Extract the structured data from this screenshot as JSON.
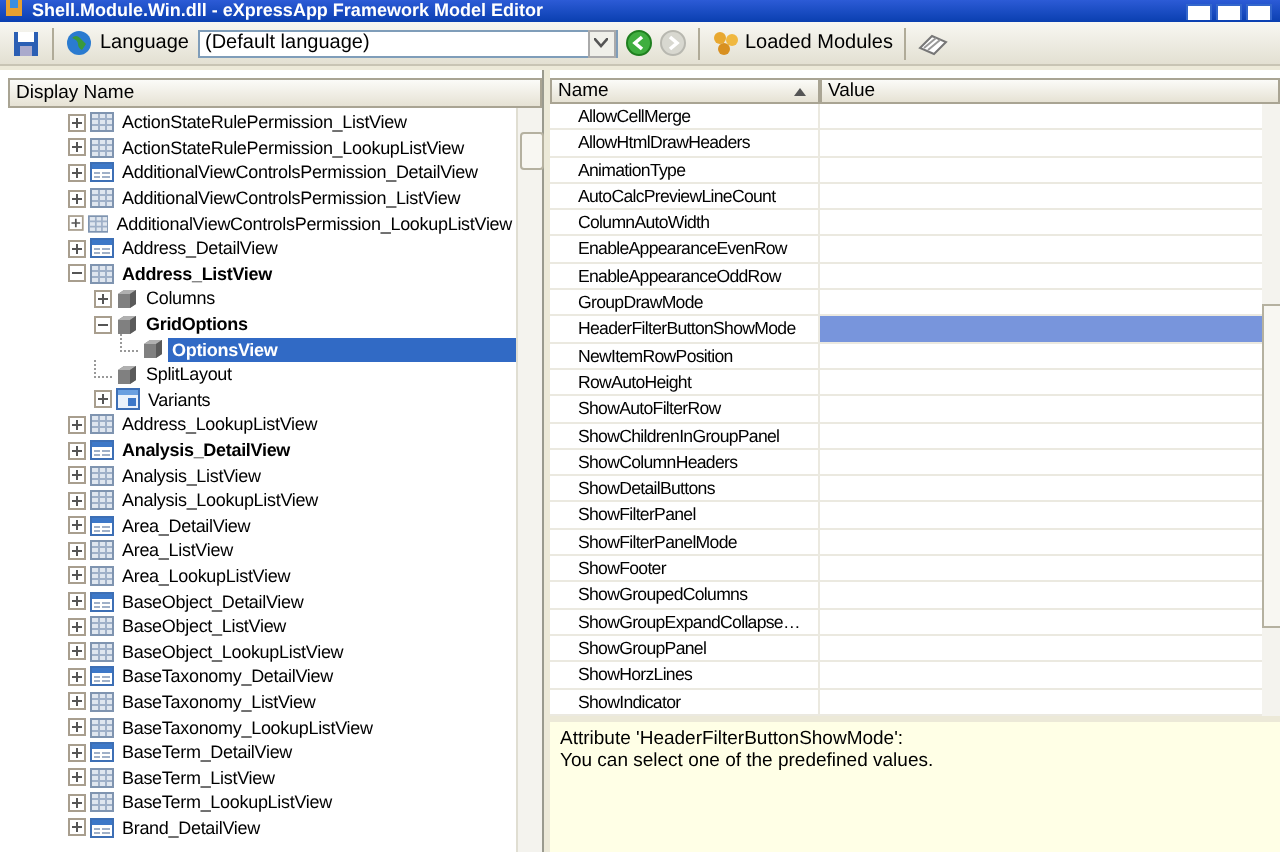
{
  "window": {
    "title": "Shell.Module.Win.dll - eXpressApp Framework Model Editor"
  },
  "toolbar": {
    "language_label": "Language",
    "language_value": "(Default language)",
    "nav_buttons": [
      {
        "kind": "back",
        "disabled": false
      },
      {
        "kind": "forward",
        "disabled": true
      }
    ],
    "loaded_modules_label": "Loaded Modules"
  },
  "tree": {
    "header": "Display Name",
    "items": [
      {
        "label": "ActionStateRulePermission_ListView",
        "kind": "list",
        "leaf": false,
        "expanded": false,
        "bold": false,
        "selected": false
      },
      {
        "label": "ActionStateRulePermission_LookupListView",
        "kind": "list",
        "leaf": false,
        "expanded": false,
        "bold": false,
        "selected": false
      },
      {
        "label": "AdditionalViewControlsPermission_DetailView",
        "kind": "detail",
        "leaf": false,
        "expanded": false,
        "bold": false,
        "selected": false
      },
      {
        "label": "AdditionalViewControlsPermission_ListView",
        "kind": "list",
        "leaf": false,
        "expanded": false,
        "bold": false,
        "selected": false
      },
      {
        "label": "AdditionalViewControlsPermission_LookupListView",
        "kind": "list",
        "leaf": false,
        "expanded": false,
        "bold": false,
        "selected": false
      },
      {
        "label": "Address_DetailView",
        "kind": "detail",
        "leaf": false,
        "expanded": false,
        "bold": false,
        "selected": false
      },
      {
        "label": "Address_ListView",
        "kind": "list",
        "leaf": false,
        "expanded": true,
        "bold": true,
        "selected": false,
        "children": [
          {
            "label": "Columns",
            "kind": "node",
            "leaf": false,
            "expanded": false,
            "bold": false,
            "selected": false
          },
          {
            "label": "GridOptions",
            "kind": "node",
            "leaf": false,
            "expanded": true,
            "bold": true,
            "selected": false,
            "children": [
              {
                "label": "OptionsView",
                "kind": "node",
                "leaf": true,
                "bold": true,
                "selected": true
              }
            ]
          },
          {
            "label": "SplitLayout",
            "kind": "node",
            "leaf": true,
            "bold": false,
            "selected": false
          },
          {
            "label": "Variants",
            "kind": "variants",
            "leaf": false,
            "expanded": false,
            "bold": false,
            "selected": false
          }
        ]
      },
      {
        "label": "Address_LookupListView",
        "kind": "list",
        "leaf": false,
        "expanded": false,
        "bold": false,
        "selected": false
      },
      {
        "label": "Analysis_DetailView",
        "kind": "detail",
        "leaf": false,
        "expanded": false,
        "bold": true,
        "selected": false
      },
      {
        "label": "Analysis_ListView",
        "kind": "list",
        "leaf": false,
        "expanded": false,
        "bold": false,
        "selected": false
      },
      {
        "label": "Analysis_LookupListView",
        "kind": "list",
        "leaf": false,
        "expanded": false,
        "bold": false,
        "selected": false
      },
      {
        "label": "Area_DetailView",
        "kind": "detail",
        "leaf": false,
        "expanded": false,
        "bold": false,
        "selected": false
      },
      {
        "label": "Area_ListView",
        "kind": "list",
        "leaf": false,
        "expanded": false,
        "bold": false,
        "selected": false
      },
      {
        "label": "Area_LookupListView",
        "kind": "list",
        "leaf": false,
        "expanded": false,
        "bold": false,
        "selected": false
      },
      {
        "label": "BaseObject_DetailView",
        "kind": "detail",
        "leaf": false,
        "expanded": false,
        "bold": false,
        "selected": false
      },
      {
        "label": "BaseObject_ListView",
        "kind": "list",
        "leaf": false,
        "expanded": false,
        "bold": false,
        "selected": false
      },
      {
        "label": "BaseObject_LookupListView",
        "kind": "list",
        "leaf": false,
        "expanded": false,
        "bold": false,
        "selected": false
      },
      {
        "label": "BaseTaxonomy_DetailView",
        "kind": "detail",
        "leaf": false,
        "expanded": false,
        "bold": false,
        "selected": false
      },
      {
        "label": "BaseTaxonomy_ListView",
        "kind": "list",
        "leaf": false,
        "expanded": false,
        "bold": false,
        "selected": false
      },
      {
        "label": "BaseTaxonomy_LookupListView",
        "kind": "list",
        "leaf": false,
        "expanded": false,
        "bold": false,
        "selected": false
      },
      {
        "label": "BaseTerm_DetailView",
        "kind": "detail",
        "leaf": false,
        "expanded": false,
        "bold": false,
        "selected": false
      },
      {
        "label": "BaseTerm_ListView",
        "kind": "list",
        "leaf": false,
        "expanded": false,
        "bold": false,
        "selected": false
      },
      {
        "label": "BaseTerm_LookupListView",
        "kind": "list",
        "leaf": false,
        "expanded": false,
        "bold": false,
        "selected": false
      },
      {
        "label": "Brand_DetailView",
        "kind": "detail",
        "leaf": false,
        "expanded": false,
        "bold": false,
        "selected": false
      }
    ]
  },
  "properties": {
    "columns": [
      "Name",
      "Value"
    ],
    "rows": [
      {
        "name": "AllowCellMerge",
        "selected": false
      },
      {
        "name": "AllowHtmlDrawHeaders",
        "selected": false
      },
      {
        "name": "AnimationType",
        "selected": false
      },
      {
        "name": "AutoCalcPreviewLineCount",
        "selected": false
      },
      {
        "name": "ColumnAutoWidth",
        "selected": false
      },
      {
        "name": "EnableAppearanceEvenRow",
        "selected": false
      },
      {
        "name": "EnableAppearanceOddRow",
        "selected": false
      },
      {
        "name": "GroupDrawMode",
        "selected": false
      },
      {
        "name": "HeaderFilterButtonShowMode",
        "selected": true
      },
      {
        "name": "NewItemRowPosition",
        "selected": false
      },
      {
        "name": "RowAutoHeight",
        "selected": false
      },
      {
        "name": "ShowAutoFilterRow",
        "selected": false
      },
      {
        "name": "ShowChildrenInGroupPanel",
        "selected": false
      },
      {
        "name": "ShowColumnHeaders",
        "selected": false
      },
      {
        "name": "ShowDetailButtons",
        "selected": false
      },
      {
        "name": "ShowFilterPanel",
        "selected": false
      },
      {
        "name": "ShowFilterPanelMode",
        "selected": false
      },
      {
        "name": "ShowFooter",
        "selected": false
      },
      {
        "name": "ShowGroupedColumns",
        "selected": false
      },
      {
        "name": "ShowGroupExpandCollapse…",
        "selected": false
      },
      {
        "name": "ShowGroupPanel",
        "selected": false
      },
      {
        "name": "ShowHorzLines",
        "selected": false
      },
      {
        "name": "ShowIndicator",
        "selected": false
      }
    ]
  },
  "description": [
    "Attribute 'HeaderFilterButtonShowMode':",
    "You can select one of the predefined values."
  ]
}
